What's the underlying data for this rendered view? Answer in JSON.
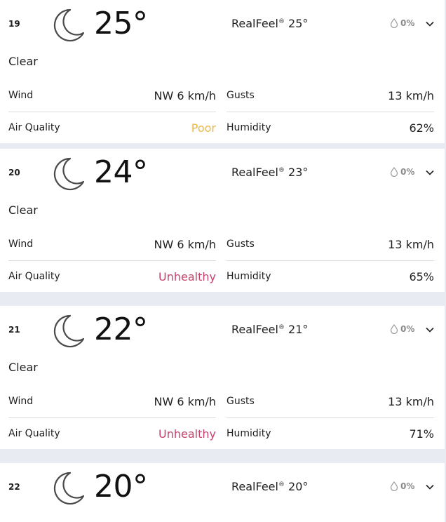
{
  "colors": {
    "poor": "#e9b741",
    "unhealthy": "#c4426b",
    "page_bg": "#e8ecf2",
    "card_bg": "#ffffff"
  },
  "icons": {
    "condition": "crescent-moon-icon",
    "precip": "water-drop-icon",
    "expand": "chevron-down-icon"
  },
  "hours": [
    {
      "hour": "19",
      "temp": "25°",
      "realfeel_label": "RealFeel",
      "realfeel_mark": "®",
      "realfeel_value": " 25°",
      "precip": "0%",
      "phrase": "Clear",
      "wind_label": "Wind",
      "wind_value": "NW 6 km/h",
      "gusts_label": "Gusts",
      "gusts_value": "13 km/h",
      "aq_label": "Air Quality",
      "aq_value": "Poor",
      "humidity_label": "Humidity",
      "humidity_value": "62%"
    },
    {
      "hour": "20",
      "temp": "24°",
      "realfeel_label": "RealFeel",
      "realfeel_mark": "®",
      "realfeel_value": " 23°",
      "precip": "0%",
      "phrase": "Clear",
      "wind_label": "Wind",
      "wind_value": "NW 6 km/h",
      "gusts_label": "Gusts",
      "gusts_value": "13 km/h",
      "aq_label": "Air Quality",
      "aq_value": "Unhealthy",
      "humidity_label": "Humidity",
      "humidity_value": "65%"
    },
    {
      "hour": "21",
      "temp": "22°",
      "realfeel_label": "RealFeel",
      "realfeel_mark": "®",
      "realfeel_value": " 21°",
      "precip": "0%",
      "phrase": "Clear",
      "wind_label": "Wind",
      "wind_value": "NW 6 km/h",
      "gusts_label": "Gusts",
      "gusts_value": "13 km/h",
      "aq_label": "Air Quality",
      "aq_value": "Unhealthy",
      "humidity_label": "Humidity",
      "humidity_value": "71%"
    },
    {
      "hour": "22",
      "temp": "20°",
      "realfeel_label": "RealFeel",
      "realfeel_mark": "®",
      "realfeel_value": " 20°",
      "precip": "0%"
    }
  ]
}
